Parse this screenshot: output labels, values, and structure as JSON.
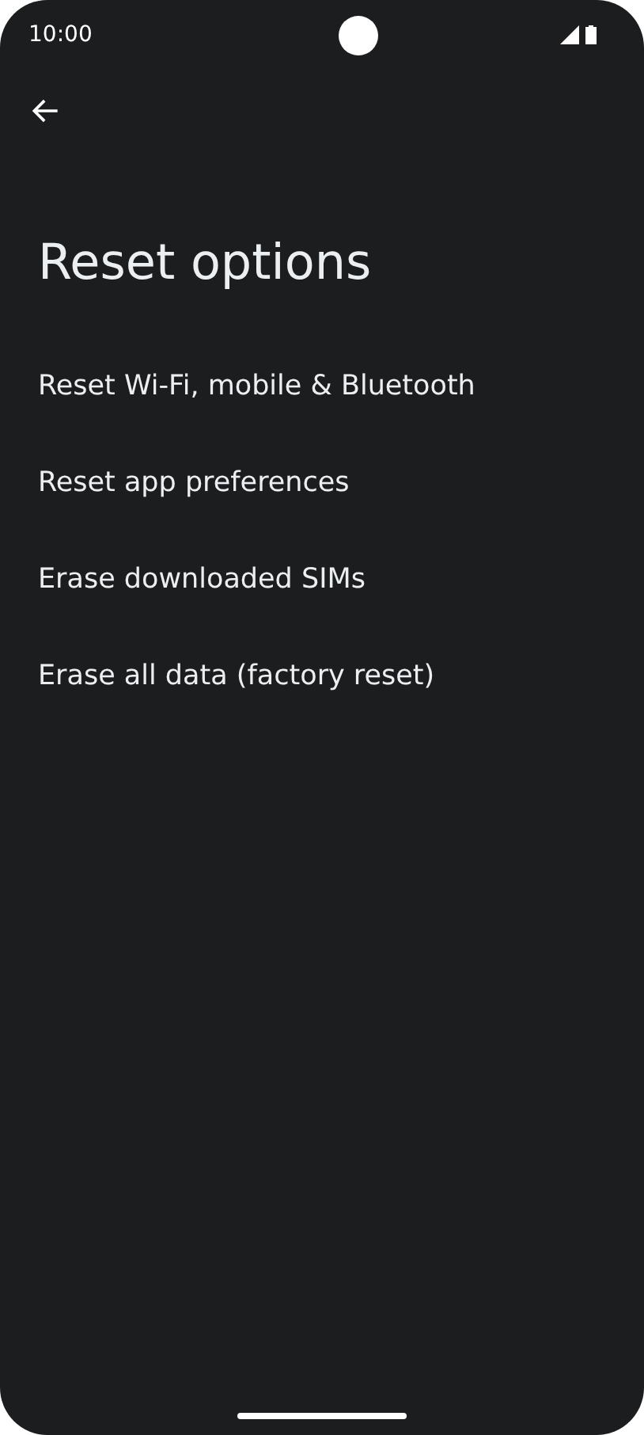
{
  "status_bar": {
    "time": "10:00"
  },
  "title": "Reset options",
  "options": [
    {
      "label": "Reset Wi-Fi, mobile & Bluetooth"
    },
    {
      "label": "Reset app preferences"
    },
    {
      "label": "Erase downloaded SIMs"
    },
    {
      "label": "Erase all data (factory reset)"
    }
  ]
}
